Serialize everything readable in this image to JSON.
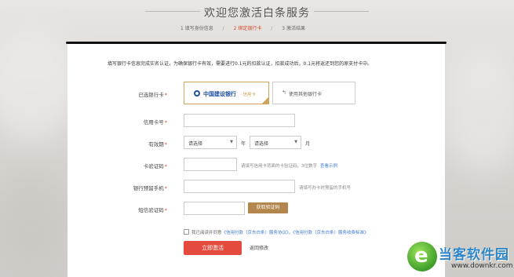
{
  "header": {
    "title": "欢迎您激活白条服务",
    "steps": [
      {
        "label": "1  填写身份信息",
        "active": false
      },
      {
        "label": "2  绑定银行卡",
        "active": true
      },
      {
        "label": "3  激活结果",
        "active": false
      }
    ],
    "separator": "/"
  },
  "notice": "填写银行卡信息完成实名认证，为确保银行卡有效，需要进行0.1元的扣款认证，扣款成功后，0.1元将返还到您的原支付卡中。",
  "form": {
    "selected_card": {
      "label": "已选银行卡",
      "required_mark": "*",
      "bank_name": "中国建设银行",
      "card_type": "· 信用卡",
      "other_option": "使用其他银行卡",
      "other_icon": "return-arrow-icon"
    },
    "card_number": {
      "label": "信用卡号",
      "required_mark": "*",
      "value": ""
    },
    "expiry": {
      "label": "有效期",
      "required_mark": "*",
      "year_select": "请选择",
      "year_unit": "年",
      "month_select": "请选择",
      "month_unit": "月"
    },
    "cvv": {
      "label": "卡验证码",
      "required_mark": "*",
      "value": "",
      "hint": "请填写信用卡背面的卡验证码，3位数字",
      "hint_link": "查看示例"
    },
    "phone": {
      "label": "银行预留手机",
      "required_mark": "*",
      "value": "",
      "hint": "请填写办卡时预留的手机号"
    },
    "sms_code": {
      "label": "短信验证码",
      "required_mark": "*",
      "value": "",
      "button": "获取验证码"
    },
    "agreement": {
      "text": "我已阅读并同意",
      "link1": "《信用付款（京东白条）服务协议》",
      "link2": "《信用付款（京东白条）服务收费标准》",
      "checked": true
    },
    "submit": "立即激活",
    "back": "返回修改"
  },
  "watermark": {
    "title": "当客软件园",
    "subtitle": "www.downkr.com"
  },
  "colors": {
    "accent_red": "#e44b3e",
    "gold": "#b2864d",
    "link_blue": "#3e7ad0"
  }
}
